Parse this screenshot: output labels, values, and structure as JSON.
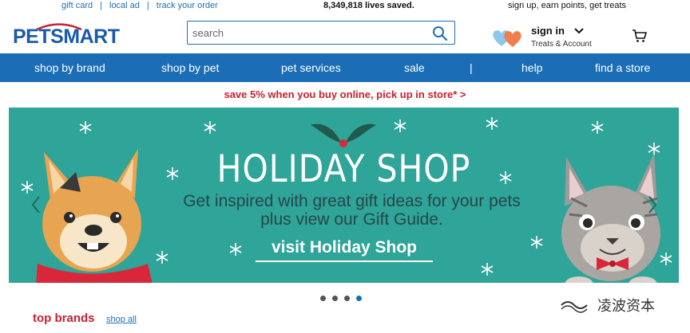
{
  "utility_bar": {
    "links": [
      "gift card",
      "local ad",
      "track your order"
    ],
    "lives_saved": "8,349,818 lives saved.",
    "rewards_promo": "sign up, earn points, get treats"
  },
  "header": {
    "logo_text": "PETSMART",
    "search": {
      "placeholder": "search",
      "value": ""
    },
    "signin_label": "sign in",
    "account_sub": "Treats & Account"
  },
  "nav": {
    "items": [
      "shop by brand",
      "shop by pet",
      "pet services",
      "sale",
      "help",
      "find a store"
    ],
    "separator": "|"
  },
  "promo_line": "save 5% when you buy online, pick up in store* >",
  "banner": {
    "title": "HOLIDAY SHOP",
    "subtitle_line1": "Get inspired with great gift ideas for your pets",
    "subtitle_line2": "plus view our Gift Guide.",
    "cta": "visit Holiday Shop",
    "bg_color": "#2fa498"
  },
  "carousel": {
    "dot_count": 4,
    "active_index": 3
  },
  "section": {
    "title": "top brands",
    "link": "shop all"
  },
  "watermark": "凌波资本",
  "colors": {
    "brand_blue": "#1b6eb5",
    "brand_red": "#c8202f",
    "teal": "#2fa498"
  }
}
